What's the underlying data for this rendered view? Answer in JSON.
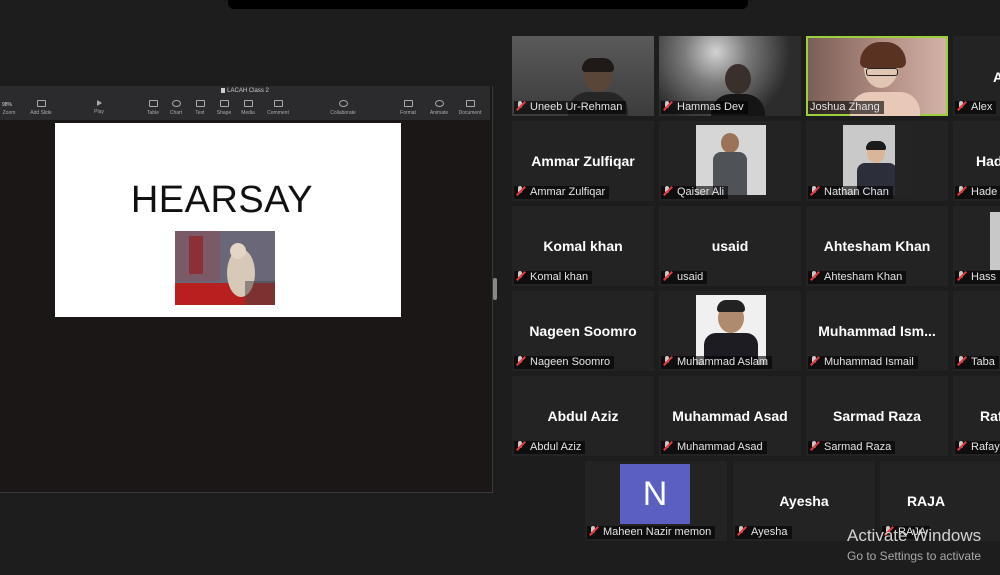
{
  "keynote": {
    "doc_title": "LACAH Class 2",
    "zoom": "98%",
    "tools": [
      "Zoom",
      "Add Slide",
      "Play",
      "Table",
      "Chart",
      "Text",
      "Shape",
      "Media",
      "Comment",
      "Collaborate",
      "Format",
      "Animate",
      "Document"
    ]
  },
  "slide": {
    "title": "HEARSAY"
  },
  "participants": [
    {
      "id": "uneeb",
      "label": "Uneeb Ur-Rehman"
    },
    {
      "id": "hammas",
      "label": "Hammas Dev"
    },
    {
      "id": "joshua",
      "label": "Joshua Zhang"
    },
    {
      "id": "alex",
      "label": "Alex"
    },
    {
      "id": "ammar",
      "big": "Ammar Zulfiqar",
      "label": "Ammar Zulfiqar"
    },
    {
      "id": "qaiser",
      "label": "Qaiser Ali"
    },
    {
      "id": "nathan",
      "label": "Nathan Chan"
    },
    {
      "id": "hade",
      "big": "Had",
      "label": "Hade"
    },
    {
      "id": "komal",
      "big": "Komal khan",
      "label": "Komal khan"
    },
    {
      "id": "usaid",
      "big": "usaid",
      "label": "usaid"
    },
    {
      "id": "ahtesham",
      "big": "Ahtesham Khan",
      "label": "Ahtesham Khan"
    },
    {
      "id": "hass",
      "label": "Hass"
    },
    {
      "id": "nageen",
      "big": "Nageen Soomro",
      "label": "Nageen Soomro"
    },
    {
      "id": "aslam",
      "label": "Muhammad Aslam"
    },
    {
      "id": "ismail",
      "big": "Muhammad  Ism...",
      "label": "Muhammad Ismail"
    },
    {
      "id": "taba",
      "label": "Taba"
    },
    {
      "id": "abdul",
      "big": "Abdul Aziz",
      "label": "Abdul Aziz"
    },
    {
      "id": "asad",
      "big": "Muhammad Asad",
      "label": "Muhammad Asad"
    },
    {
      "id": "sarmad",
      "big": "Sarmad Raza",
      "label": "Sarmad Raza"
    },
    {
      "id": "rafay",
      "big": "Raf",
      "label": "Rafay"
    },
    {
      "id": "maheen",
      "avatar": "N",
      "label": "Maheen Nazir memon"
    },
    {
      "id": "ayesha",
      "big": "Ayesha",
      "label": "Ayesha"
    },
    {
      "id": "raja",
      "big": "RAJA",
      "label": "RAJA"
    }
  ],
  "watermark": {
    "line1": "Activate Windows",
    "line2": "Go to Settings to activate"
  },
  "colors": {
    "active_speaker": "#9ccf3e",
    "muted_mic": "#e8383d",
    "avatar_bg": "#5b5fc0"
  }
}
